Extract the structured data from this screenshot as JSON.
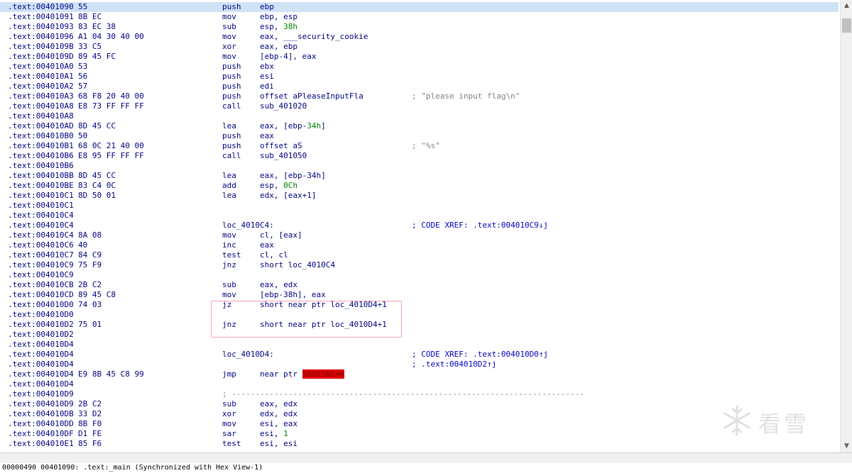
{
  "listing": {
    "lines": [
      {
        "a": ".text:00401090",
        "b": "55",
        "m": "push",
        "o": "ebp"
      },
      {
        "a": ".text:00401091",
        "b": "8B EC",
        "m": "mov",
        "o": "ebp, esp"
      },
      {
        "a": ".text:00401093",
        "b": "83 EC 38",
        "m": "sub",
        "o": "esp, ",
        "n": "38h"
      },
      {
        "a": ".text:00401096",
        "b": "A1 04 30 40 00",
        "m": "mov",
        "o": "eax, ___security_cookie"
      },
      {
        "a": ".text:0040109B",
        "b": "33 C5",
        "m": "xor",
        "o": "eax, ebp"
      },
      {
        "a": ".text:0040109D",
        "b": "89 45 FC",
        "m": "mov",
        "o": "[ebp-4], eax"
      },
      {
        "a": ".text:004010A0",
        "b": "53",
        "m": "push",
        "o": "ebx"
      },
      {
        "a": ".text:004010A1",
        "b": "56",
        "m": "push",
        "o": "esi"
      },
      {
        "a": ".text:004010A2",
        "b": "57",
        "m": "push",
        "o": "edi"
      },
      {
        "a": ".text:004010A3",
        "b": "68 F8 20 40 00",
        "m": "push",
        "o": "offset aPleaseInputFla",
        "c": "; \"please input flag\\n\""
      },
      {
        "a": ".text:004010A8",
        "b": "E8 73 FF FF FF",
        "m": "call",
        "o": "sub_401020"
      },
      {
        "a": ".text:004010A8"
      },
      {
        "a": ".text:004010AD",
        "b": "8D 45 CC",
        "m": "lea",
        "o": "eax, [ebp-",
        "n": "34h",
        "o2": "]"
      },
      {
        "a": ".text:004010B0",
        "b": "50",
        "m": "push",
        "o": "eax"
      },
      {
        "a": ".text:004010B1",
        "b": "68 0C 21 40 00",
        "m": "push",
        "o": "offset aS",
        "c": "; \"%s\""
      },
      {
        "a": ".text:004010B6",
        "b": "E8 95 FF FF FF",
        "m": "call",
        "o": "sub_401050"
      },
      {
        "a": ".text:004010B6"
      },
      {
        "a": ".text:004010BB",
        "b": "8D 45 CC",
        "m": "lea",
        "o": "eax, [ebp-34h]"
      },
      {
        "a": ".text:004010BE",
        "b": "83 C4 0C",
        "m": "add",
        "o": "esp, ",
        "n": "0Ch"
      },
      {
        "a": ".text:004010C1",
        "b": "8D 50 01",
        "m": "lea",
        "o": "edx, [eax+1]"
      },
      {
        "a": ".text:004010C1"
      },
      {
        "a": ".text:004010C4"
      },
      {
        "a": ".text:004010C4",
        "l": "loc_4010C4:",
        "x": "; CODE XREF: .text:004010C9↓j"
      },
      {
        "a": ".text:004010C4",
        "b": "8A 08",
        "m": "mov",
        "o": "cl, [eax]"
      },
      {
        "a": ".text:004010C6",
        "b": "40",
        "m": "inc",
        "o": "eax"
      },
      {
        "a": ".text:004010C7",
        "b": "84 C9",
        "m": "test",
        "o": "cl, cl"
      },
      {
        "a": ".text:004010C9",
        "b": "75 F9",
        "m": "jnz",
        "o": "short loc_4010C4"
      },
      {
        "a": ".text:004010C9"
      },
      {
        "a": ".text:004010CB",
        "b": "2B C2",
        "m": "sub",
        "o": "eax, edx"
      },
      {
        "a": ".text:004010CD",
        "b": "89 45 C8",
        "m": "mov",
        "o": "[ebp-38h], eax"
      },
      {
        "a": ".text:004010D0",
        "b": "74 03",
        "m": "jz",
        "o": "short near ptr loc_4010D4+1"
      },
      {
        "a": ".text:004010D0"
      },
      {
        "a": ".text:004010D2",
        "b": "75 01",
        "m": "jnz",
        "o": "short near ptr loc_4010D4+1"
      },
      {
        "a": ".text:004010D2"
      },
      {
        "a": ".text:004010D4"
      },
      {
        "a": ".text:004010D4",
        "l": "loc_4010D4:",
        "x": "; CODE XREF: .text:004010D0↑j"
      },
      {
        "a": ".text:004010D4",
        "x": "; .text:004010D2↑j"
      },
      {
        "a": ".text:004010D4",
        "b": "E9 8B 45 C8 99",
        "m": "jmp",
        "o": "near ptr ",
        "h": "9A085664h"
      },
      {
        "a": ".text:004010D4"
      },
      {
        "a": ".text:004010D9",
        "s": "; ---------------------------------------------------------------------------"
      },
      {
        "a": ".text:004010D9",
        "b": "2B C2",
        "m": "sub",
        "o": "eax, edx"
      },
      {
        "a": ".text:004010DB",
        "b": "33 D2",
        "m": "xor",
        "o": "edx, edx"
      },
      {
        "a": ".text:004010DD",
        "b": "8B F0",
        "m": "mov",
        "o": "esi, eax"
      },
      {
        "a": ".text:004010DF",
        "b": "D1 FE",
        "m": "sar",
        "o": "esi, ",
        "n": "1"
      },
      {
        "a": ".text:004010E1",
        "b": "85 F6",
        "m": "test",
        "o": "esi, esi"
      }
    ]
  },
  "status": {
    "text": "00000490 00401090: .text:_main (Synchronized with Hex View-1)"
  },
  "watermark": {
    "text": "看雪",
    "icon": "snowflake-icon"
  },
  "scrollbar": {
    "up_icon": "▲",
    "down_icon": "▼"
  },
  "colors": {
    "address": "#000080",
    "number": "#008000",
    "comment": "#808080",
    "highlight": "#e00000",
    "box": "#f3a3b7"
  }
}
